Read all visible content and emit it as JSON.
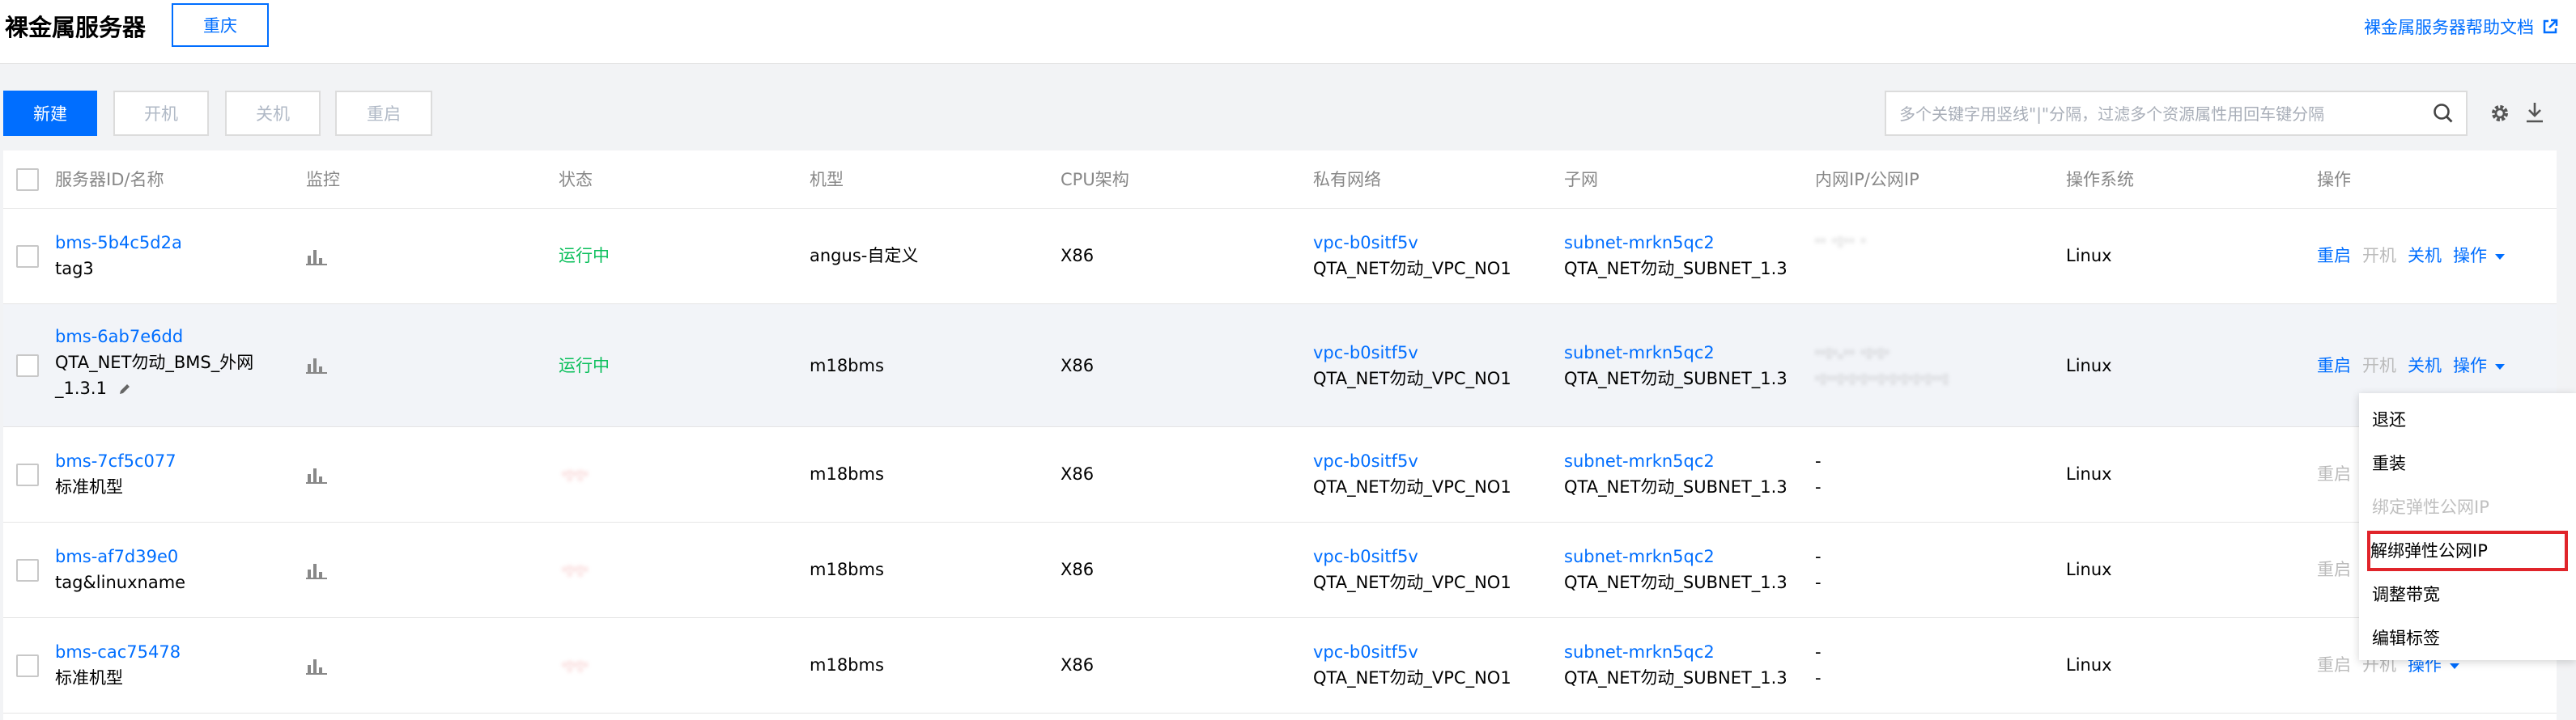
{
  "header": {
    "title": "裸金属服务器",
    "region": "重庆",
    "help_link": "裸金属服务器帮助文档"
  },
  "toolbar": {
    "new_label": "新建",
    "start_label": "开机",
    "stop_label": "关机",
    "restart_label": "重启",
    "search_placeholder": "多个关键字用竖线\"|\"分隔，过滤多个资源属性用回车键分隔"
  },
  "table": {
    "columns": [
      "服务器ID/名称",
      "监控",
      "状态",
      "机型",
      "CPU架构",
      "私有网络",
      "子网",
      "内网IP/公网IP",
      "操作系统",
      "操作"
    ],
    "rows": [
      {
        "id": "bms-5b4c5d2a",
        "name": "tag3",
        "status": "运行中",
        "model": "angus-自定义",
        "cpu": "X86",
        "vpc": "vpc-b0sitf5v",
        "vpc_name": "QTA_NET勿动_VPC_NO1",
        "subnet": "subnet-mrkn5qc2",
        "subnet_name": "QTA_NET勿动_SUBNET_1.3",
        "ip_private": "·· ·:·· ·",
        "ip_public": "",
        "os": "Linux",
        "op_restart": "重启",
        "op_start": "开机",
        "op_stop": "关机",
        "op_more": "操作"
      },
      {
        "id": "bms-6ab7e6dd",
        "name": "QTA_NET勿动_BMS_外网",
        "name_line2": "_1.3.1",
        "status": "运行中",
        "model": "m18bms",
        "cpu": "X86",
        "vpc": "vpc-b0sitf5v",
        "vpc_name": "QTA_NET勿动_VPC_NO1",
        "subnet": "subnet-mrkn5qc2",
        "subnet_name": "QTA_NET勿动_SUBNET_1.3",
        "ip_private": "··:·.·· ·:·:·",
        "ip_public": "·:··:·:·:··:·:·:·:·:··:",
        "os": "Linux",
        "op_restart": "重启",
        "op_start": "开机",
        "op_stop": "关机",
        "op_more": "操作"
      },
      {
        "id": "bms-7cf5c077",
        "name": "标准机型",
        "status": "·:·:·",
        "model": "m18bms",
        "cpu": "X86",
        "vpc": "vpc-b0sitf5v",
        "vpc_name": "QTA_NET勿动_VPC_NO1",
        "subnet": "subnet-mrkn5qc2",
        "subnet_name": "QTA_NET勿动_SUBNET_1.3",
        "ip_private": "-",
        "ip_public": "-",
        "os": "Linux",
        "op_restart": "重启",
        "op_start": "",
        "op_stop": "",
        "op_more": ""
      },
      {
        "id": "bms-af7d39e0",
        "name": "tag&linuxname",
        "status": "·:·:·",
        "model": "m18bms",
        "cpu": "X86",
        "vpc": "vpc-b0sitf5v",
        "vpc_name": "QTA_NET勿动_VPC_NO1",
        "subnet": "subnet-mrkn5qc2",
        "subnet_name": "QTA_NET勿动_SUBNET_1.3",
        "ip_private": "-",
        "ip_public": "-",
        "os": "Linux",
        "op_restart": "重启",
        "op_start": "",
        "op_stop": "",
        "op_more": ""
      },
      {
        "id": "bms-cac75478",
        "name": "标准机型",
        "status": "·:·:·",
        "model": "m18bms",
        "cpu": "X86",
        "vpc": "vpc-b0sitf5v",
        "vpc_name": "QTA_NET勿动_VPC_NO1",
        "subnet": "subnet-mrkn5qc2",
        "subnet_name": "QTA_NET勿动_SUBNET_1.3",
        "ip_private": "-",
        "ip_public": "-",
        "os": "Linux",
        "op_restart": "重启",
        "op_start": "开机",
        "op_stop": "操作",
        "op_more": ""
      }
    ]
  },
  "dropdown_menu": {
    "items": [
      "退还",
      "重装",
      "绑定弹性公网IP",
      "解绑弹性公网IP",
      "调整带宽",
      "编辑标签"
    ]
  },
  "colors": {
    "accent": "#006eff",
    "running": "#0abf5b",
    "highlight": "#e0242a"
  }
}
